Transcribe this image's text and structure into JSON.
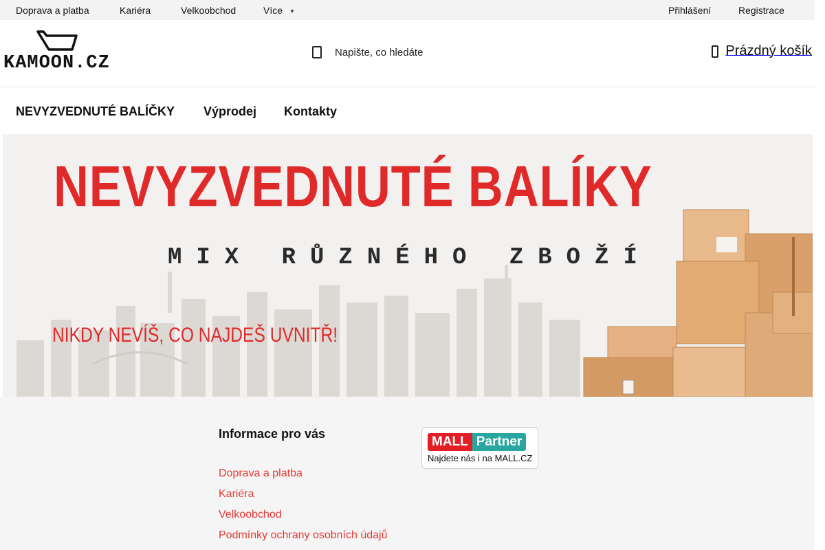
{
  "topbar": {
    "links": [
      "Doprava a platba",
      "Kariéra",
      "Velkoobchod",
      "Více"
    ],
    "login": "Přihlášení",
    "register": "Registrace"
  },
  "header": {
    "logo_text": "KAMOON.CZ",
    "search_placeholder": "Napište, co hledáte",
    "cart_label": "Prázdný košík"
  },
  "nav": {
    "items": [
      "NEVYZVEDNUTÉ BALÍČKY",
      "Výprodej",
      "Kontakty"
    ]
  },
  "banner": {
    "title": "NEVYZVEDNUTÉ BALÍKY",
    "subtitle": "MIX RŮZNÉHO ZBOŽÍ",
    "tagline": "NIKDY NEVÍŠ, CO NAJDEŠ UVNITŘ!"
  },
  "footer": {
    "info_title": "Informace pro vás",
    "links": [
      "Doprava a platba",
      "Kariéra",
      "Velkoobchod",
      "Podmínky ochrany osobních údajů"
    ],
    "mall_badge": {
      "brand": "MALL",
      "partner": "Partner",
      "subtitle": "Najdete nás i na MALL.CZ"
    }
  },
  "colors": {
    "accent_red": "#e53935",
    "banner_red": "#e02a2a",
    "topbar_bg": "#f3f3f3",
    "footer_bg": "#f5f5f5",
    "mall_red": "#e31e24",
    "mall_teal": "#2aa6a0"
  },
  "icons": {
    "search": "search-icon",
    "cart": "cart-icon",
    "more": "chevron-down-icon",
    "logo": "basket-logo-icon"
  }
}
